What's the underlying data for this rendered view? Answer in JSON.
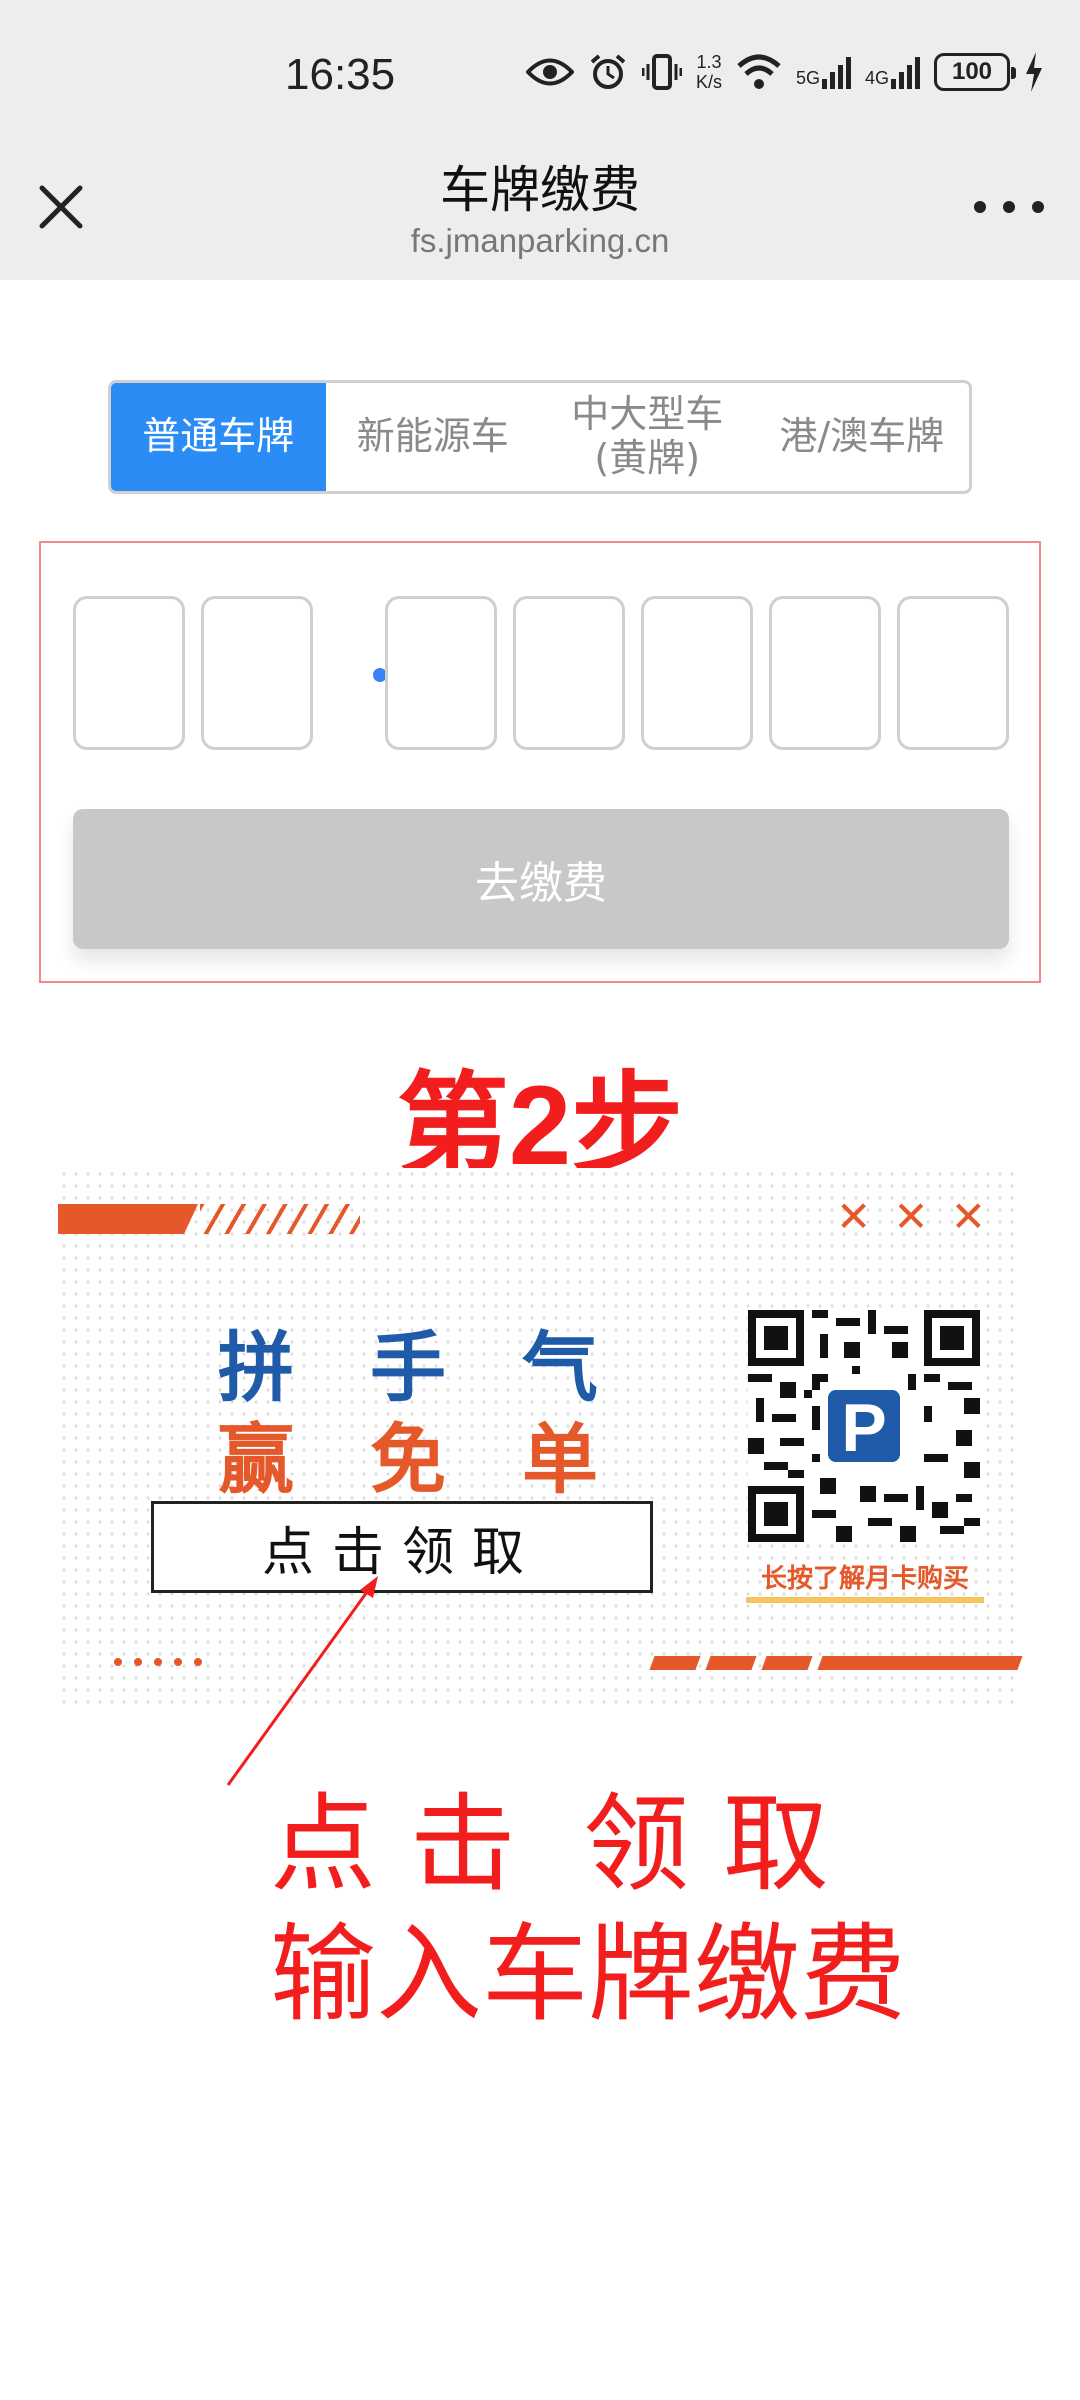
{
  "status_bar": {
    "time": "16:35",
    "net_speed": [
      "1.3",
      "K/s"
    ],
    "signal_1": "5G",
    "signal_2": "4G",
    "battery": "100",
    "icons": [
      "eye-icon",
      "alarm-icon",
      "vibrate-icon",
      "wifi-icon",
      "signal-5g-icon",
      "signal-4g-icon",
      "battery-icon",
      "charging-icon"
    ]
  },
  "header": {
    "title": "车牌缴费",
    "url": "fs.jmanparking.cn"
  },
  "plate_tabs": [
    {
      "label": "普通车牌",
      "active": true
    },
    {
      "label": "新能源车",
      "active": false
    },
    {
      "label": "中大型车\n(黄牌)",
      "active": false
    },
    {
      "label": "港/澳车牌",
      "active": false
    }
  ],
  "plate_input": {
    "cells": [
      "",
      "",
      "",
      "",
      "",
      "",
      ""
    ],
    "pay_button": "去缴费"
  },
  "step_label": "第2步",
  "banner": {
    "crosses": [
      "✕",
      "✕",
      "✕"
    ],
    "line1": [
      "拼",
      "手",
      "气"
    ],
    "line2": [
      "赢",
      "免",
      "单"
    ],
    "cta": "点击领取",
    "qr_caption": "长按了解月卡购买",
    "qr_badge": "P",
    "colors": {
      "blue": "#1f5ba8",
      "orange": "#e4582a",
      "yellow": "#f6c45c"
    }
  },
  "instructions": {
    "line1": "点 击  领 取",
    "line2": "输入车牌缴费"
  },
  "colors": {
    "accent_blue": "#2a8cf4",
    "red_annotation": "#f21d1d",
    "disabled_button": "#c8c8c8"
  }
}
